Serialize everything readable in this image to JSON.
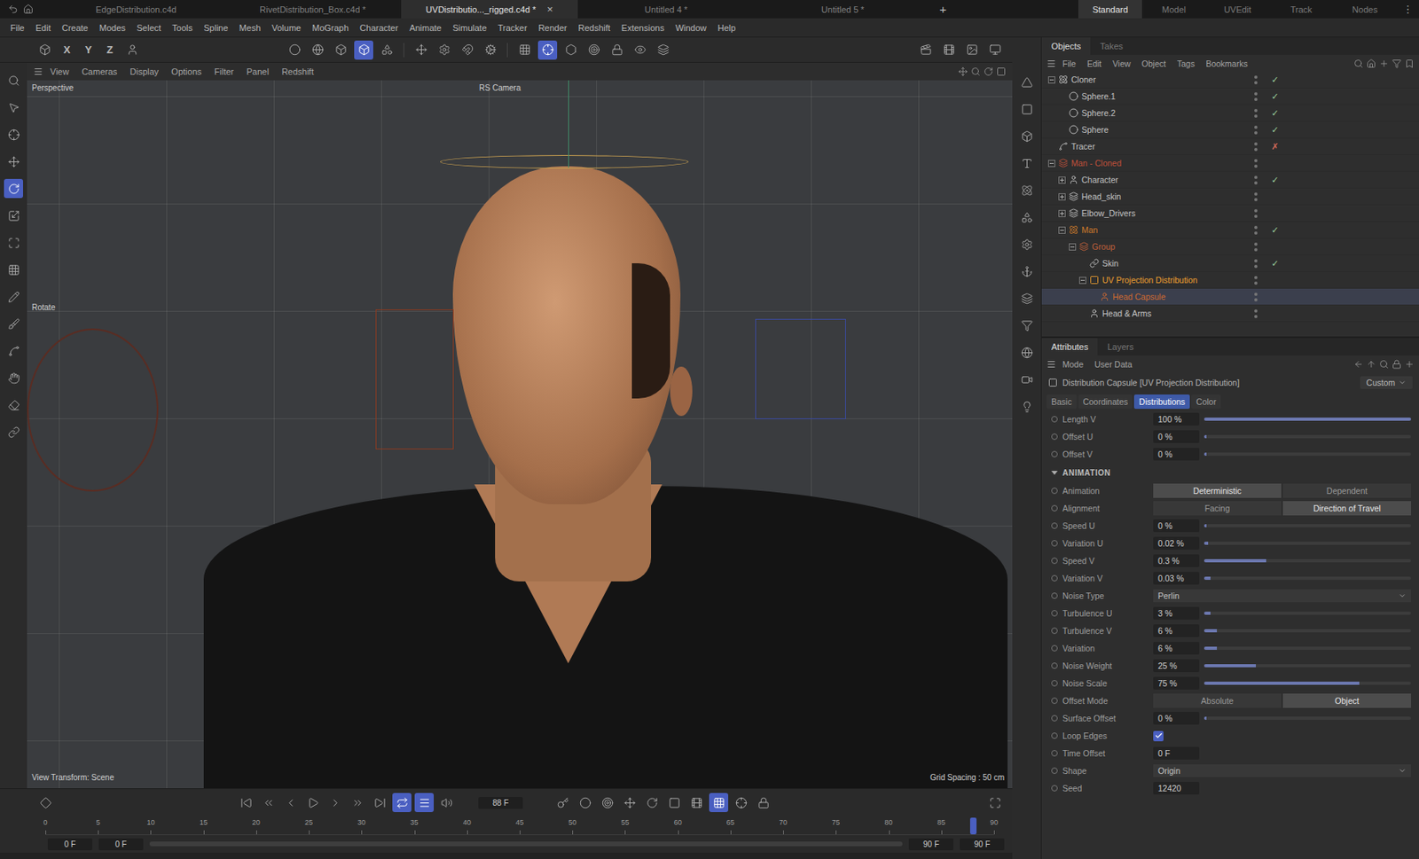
{
  "file_tabs": [
    {
      "label": "EdgeDistribution.c4d",
      "selected": false,
      "close": ""
    },
    {
      "label": "RivetDistribution_Box.c4d *",
      "selected": false,
      "close": ""
    },
    {
      "label": "UVDistributio..._rigged.c4d *",
      "selected": true,
      "close": "×"
    },
    {
      "label": "Untitled 4 *",
      "selected": false,
      "close": ""
    },
    {
      "label": "Untitled 5 *",
      "selected": false,
      "close": ""
    }
  ],
  "new_tab": "+",
  "layouts": [
    {
      "label": "Standard",
      "selected": true
    },
    {
      "label": "Model",
      "selected": false
    },
    {
      "label": "UVEdit",
      "selected": false
    },
    {
      "label": "Track",
      "selected": false
    },
    {
      "label": "Nodes",
      "selected": false
    }
  ],
  "layout_more": "⋮",
  "menu": [
    "File",
    "Edit",
    "Create",
    "Modes",
    "Select",
    "Tools",
    "Spline",
    "Mesh",
    "Volume",
    "MoGraph",
    "Character",
    "Animate",
    "Simulate",
    "Tracker",
    "Render",
    "Redshift",
    "Extensions",
    "Window",
    "Help"
  ],
  "toolbar": {
    "axes": [
      "X",
      "Y",
      "Z"
    ],
    "tools": [
      {
        "selected": false
      },
      {
        "selected": false
      },
      {
        "selected": false
      },
      {
        "selected": true
      },
      {
        "selected": false
      },
      {
        "selected": false
      },
      {
        "selected": false
      },
      {
        "selected": false
      },
      {
        "selected": false
      },
      {
        "selected": false
      },
      {
        "selected": true
      },
      {
        "selected": false
      },
      {
        "selected": false
      },
      {
        "selected": false
      },
      {
        "selected": false
      },
      {
        "selected": false
      },
      {
        "selected": false
      },
      {
        "selected": false
      },
      {
        "selected": false
      },
      {
        "selected": false
      }
    ]
  },
  "left_tools": [
    {
      "selected": false
    },
    {
      "selected": false
    },
    {
      "selected": false
    },
    {
      "selected": false
    },
    {
      "selected": true
    },
    {
      "selected": false
    },
    {
      "selected": false
    },
    {
      "selected": false
    },
    {
      "selected": false
    },
    {
      "selected": false
    },
    {
      "selected": false
    },
    {
      "selected": false
    },
    {
      "selected": false
    },
    {
      "selected": false
    }
  ],
  "right_tools": [
    {
      "selected": false
    },
    {
      "selected": false
    },
    {
      "selected": false
    },
    {
      "selected": false
    },
    {
      "selected": false
    },
    {
      "selected": false
    },
    {
      "selected": false
    },
    {
      "selected": false
    },
    {
      "selected": false
    },
    {
      "selected": false
    },
    {
      "selected": false
    },
    {
      "selected": false
    },
    {
      "selected": false
    }
  ],
  "viewport": {
    "menu": [
      "View",
      "Cameras",
      "Display",
      "Options",
      "Filter",
      "Panel",
      "Redshift"
    ],
    "view_name": "Perspective",
    "camera": "RS Camera",
    "tool_hint": "Rotate",
    "transform": "View Transform: Scene",
    "grid": "Grid Spacing : 50 cm"
  },
  "objects": {
    "tabs": [
      {
        "label": "Objects",
        "selected": true
      },
      {
        "label": "Takes",
        "selected": false
      }
    ],
    "menu": [
      "File",
      "Edit",
      "View",
      "Object",
      "Tags",
      "Bookmarks"
    ],
    "rows": [
      {
        "name": "Cloner",
        "depth": 0,
        "expandable": true,
        "expanded": true,
        "status": "✓",
        "color": "#c4c4c4",
        "selected": false
      },
      {
        "name": "Sphere.1",
        "depth": 1,
        "expandable": false,
        "expanded": false,
        "status": "✓",
        "color": "#c4c4c4",
        "selected": false
      },
      {
        "name": "Sphere.2",
        "depth": 1,
        "expandable": false,
        "expanded": false,
        "status": "✓",
        "color": "#c4c4c4",
        "selected": false
      },
      {
        "name": "Sphere",
        "depth": 1,
        "expandable": false,
        "expanded": false,
        "status": "✓",
        "color": "#c4c4c4",
        "selected": false
      },
      {
        "name": "Tracer",
        "depth": 0,
        "expandable": false,
        "expanded": false,
        "status": "✗",
        "color": "#c4c4c4",
        "selected": false
      },
      {
        "name": "Man - Cloned",
        "depth": 0,
        "expandable": true,
        "expanded": true,
        "status": "",
        "color": "#c0503a",
        "selected": false
      },
      {
        "name": "Character",
        "depth": 1,
        "expandable": true,
        "expanded": false,
        "status": "✓",
        "color": "#c4c4c4",
        "selected": false
      },
      {
        "name": "Head_skin",
        "depth": 1,
        "expandable": true,
        "expanded": false,
        "status": "",
        "color": "#c4c4c4",
        "selected": false
      },
      {
        "name": "Elbow_Drivers",
        "depth": 1,
        "expandable": true,
        "expanded": false,
        "status": "",
        "color": "#c4c4c4",
        "selected": false
      },
      {
        "name": "Man",
        "depth": 1,
        "expandable": true,
        "expanded": true,
        "status": "✓",
        "color": "#d07a2a",
        "selected": false
      },
      {
        "name": "Group",
        "depth": 2,
        "expandable": true,
        "expanded": true,
        "status": "",
        "color": "#c0603a",
        "selected": false
      },
      {
        "name": "Skin",
        "depth": 3,
        "expandable": false,
        "expanded": false,
        "status": "✓",
        "color": "#c4c4c4",
        "selected": false
      },
      {
        "name": "UV Projection Distribution",
        "depth": 3,
        "expandable": true,
        "expanded": true,
        "status": "",
        "color": "#f0a030",
        "selected": false
      },
      {
        "name": "Head Capsule",
        "depth": 4,
        "expandable": false,
        "expanded": false,
        "status": "",
        "color": "#d06a30",
        "selected": true
      },
      {
        "name": "Head & Arms",
        "depth": 3,
        "expandable": false,
        "expanded": false,
        "status": "",
        "color": "#c4c4c4",
        "selected": false
      }
    ]
  },
  "attributes": {
    "tabs": [
      {
        "label": "Attributes",
        "selected": true
      },
      {
        "label": "Layers",
        "selected": false
      }
    ],
    "menu": [
      "Mode",
      "User Data"
    ],
    "title": "Distribution Capsule [UV Projection Distribution]",
    "preset": "Custom",
    "subtabs": [
      {
        "label": "Basic",
        "selected": false
      },
      {
        "label": "Coordinates",
        "selected": false
      },
      {
        "label": "Distributions",
        "selected": true
      },
      {
        "label": "Color",
        "selected": false
      }
    ],
    "rows": [
      {
        "kind": "slider",
        "label": "Length V",
        "value": "100 %",
        "level": 1
      },
      {
        "kind": "slider",
        "label": "Offset U",
        "value": "0 %",
        "level": 0
      },
      {
        "kind": "slider",
        "label": "Offset V",
        "value": "0 %",
        "level": 0
      },
      {
        "kind": "section",
        "label": "ANIMATION"
      },
      {
        "kind": "segment",
        "label": "Animation",
        "options": [
          {
            "label": "Deterministic",
            "selected": true
          },
          {
            "label": "Dependent",
            "selected": false
          }
        ]
      },
      {
        "kind": "segment",
        "label": "Alignment",
        "options": [
          {
            "label": "Facing",
            "selected": false
          },
          {
            "label": "Direction of Travel",
            "selected": true
          }
        ]
      },
      {
        "kind": "slider",
        "label": "Speed U",
        "value": "0 %",
        "level": 0
      },
      {
        "kind": "slider",
        "label": "Variation U",
        "value": "0.02 %",
        "level": 0.02
      },
      {
        "kind": "slider",
        "label": "Speed V",
        "value": "0.3 %",
        "level": 0.3
      },
      {
        "kind": "slider",
        "label": "Variation V",
        "value": "0.03 %",
        "level": 0.03
      },
      {
        "kind": "dropdown",
        "label": "Noise Type",
        "value": "Perlin"
      },
      {
        "kind": "slider",
        "label": "Turbulence U",
        "value": "3 %",
        "level": 0.03
      },
      {
        "kind": "slider",
        "label": "Turbulence V",
        "value": "6 %",
        "level": 0.06
      },
      {
        "kind": "slider",
        "label": "Variation",
        "value": "6 %",
        "level": 0.06
      },
      {
        "kind": "slider",
        "label": "Noise Weight",
        "value": "25 %",
        "level": 0.25
      },
      {
        "kind": "slider",
        "label": "Noise Scale",
        "value": "75 %",
        "level": 0.75
      },
      {
        "kind": "segment",
        "label": "Offset Mode",
        "options": [
          {
            "label": "Absolute",
            "selected": false
          },
          {
            "label": "Object",
            "selected": true
          }
        ]
      },
      {
        "kind": "slider",
        "label": "Surface Offset",
        "value": "0 %",
        "level": 0
      },
      {
        "kind": "checkbox",
        "label": "Loop Edges",
        "checked": true
      },
      {
        "kind": "field",
        "label": "Time Offset",
        "value": "0 F"
      },
      {
        "kind": "dropdown",
        "label": "Shape",
        "value": "Origin"
      },
      {
        "kind": "field",
        "label": "Seed",
        "value": "12420"
      }
    ]
  },
  "timeline": {
    "current": "88 F",
    "start": "0 F",
    "min": "0 F",
    "max": "90 F",
    "end": "90 F",
    "ticks": [
      "0",
      "5",
      "10",
      "15",
      "20",
      "25",
      "30",
      "35",
      "40",
      "45",
      "50",
      "55",
      "60",
      "65",
      "70",
      "75",
      "80",
      "85",
      "90"
    ],
    "level": 0.978,
    "tools_left": [
      {
        "selected": false
      },
      {
        "selected": false
      },
      {
        "selected": false
      },
      {
        "selected": false
      },
      {
        "selected": false
      },
      {
        "selected": false
      },
      {
        "selected": false
      },
      {
        "selected": false
      },
      {
        "selected": true
      },
      {
        "selected": true
      },
      {
        "selected": false
      }
    ],
    "tools_right": [
      {
        "selected": false
      },
      {
        "selected": false
      },
      {
        "selected": false
      },
      {
        "selected": false
      },
      {
        "selected": false
      },
      {
        "selected": false
      },
      {
        "selected": false
      },
      {
        "selected": true
      },
      {
        "selected": false
      },
      {
        "selected": false
      },
      {
        "selected": false
      }
    ]
  }
}
